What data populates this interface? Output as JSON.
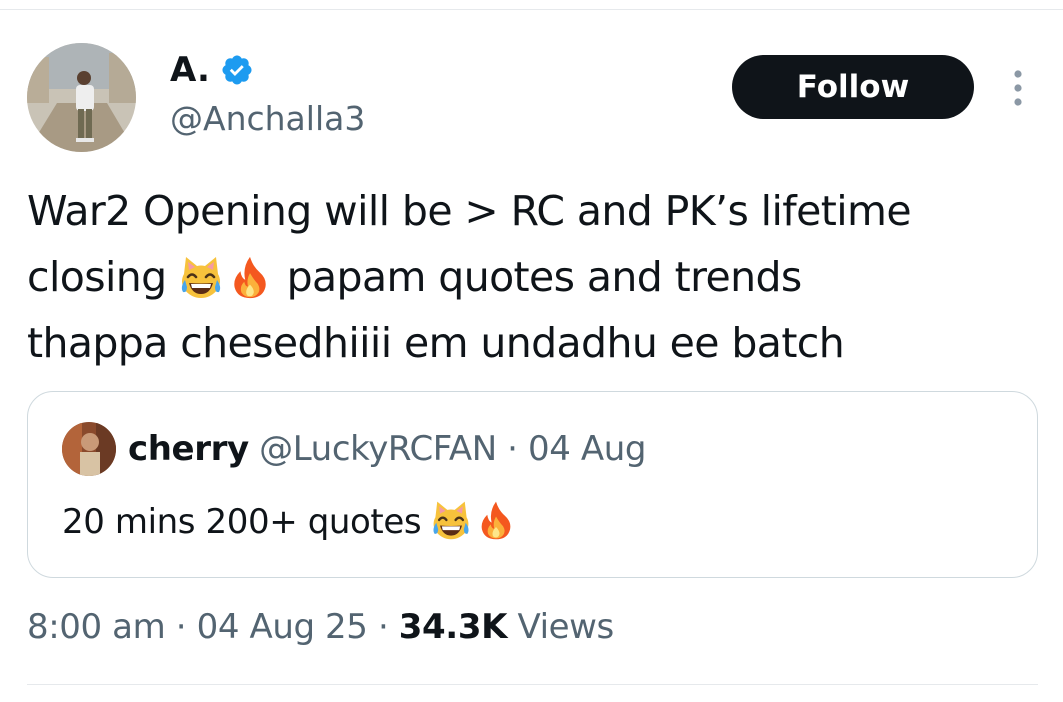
{
  "author": {
    "display_name": "A.",
    "handle": "@Anchalla3",
    "verified": true,
    "verified_color": "#1d9bf0"
  },
  "follow_button": {
    "label": "Follow"
  },
  "more_menu_icon": "more-vertical-icon",
  "tweet": {
    "text_line1": "War2 Opening will be > RC and PK’s lifetime",
    "text_line2_a": "closing",
    "text_line2_b": "papam quotes and trends",
    "text_line3": "thappa chesedhiiii em undadhu ee batch",
    "emojis": [
      "cat-tears-of-joy-emoji",
      "fire-emoji"
    ]
  },
  "quoted_tweet": {
    "display_name": "cherry",
    "handle": "@LuckyRCFAN",
    "separator": "·",
    "date": "04 Aug",
    "text": "20 mins 200+ quotes",
    "emojis": [
      "cat-tears-of-joy-emoji",
      "fire-emoji"
    ]
  },
  "meta": {
    "time": "8:00 am",
    "separator": "·",
    "date": "04 Aug 25",
    "views_count": "34.3K",
    "views_label": "Views"
  },
  "colors": {
    "text_primary": "#0f1419",
    "text_secondary": "#536471",
    "border": "#cfd9de",
    "button_bg": "#0f1419"
  }
}
